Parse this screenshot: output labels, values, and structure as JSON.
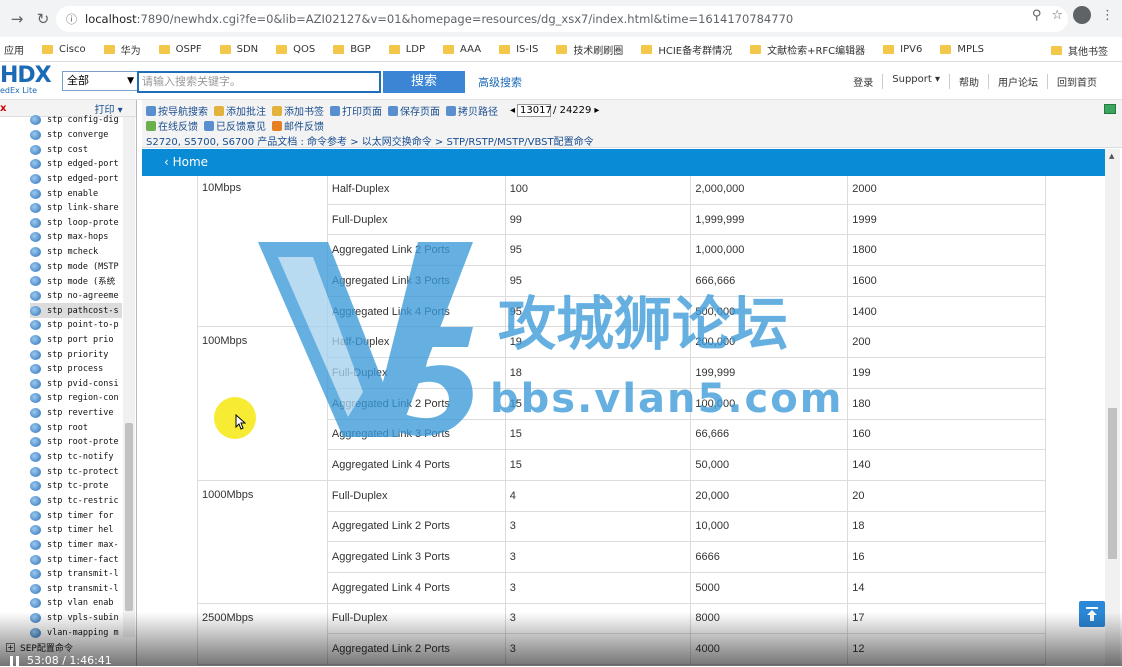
{
  "browser": {
    "url_host": "localhost",
    "url_rest": ":7890/newhdx.cgi?fe=0&lib=AZI02127&v=01&homepage=resources/dg_xsx7/index.html&time=1614170784770",
    "bookmarks": [
      "应用",
      "Cisco",
      "华为",
      "OSPF",
      "SDN",
      "QOS",
      "BGP",
      "LDP",
      "AAA",
      "IS-IS",
      "技术刷刷圈",
      "HCIE备考群情况",
      "文献检索+RFC编辑器",
      "IPV6",
      "MPLS"
    ],
    "other_bookmarks": "其他书签"
  },
  "header": {
    "logo_big": "HDX",
    "logo_small": "edEx Lite",
    "scope": "全部",
    "search_placeholder": "请输入搜索关键字。",
    "search_button": "搜索",
    "advanced_search": "高级搜索",
    "links": [
      "登录",
      "Support ▾",
      "帮助",
      "用户论坛",
      "回到首页"
    ]
  },
  "left_panel": {
    "close": "x",
    "print": "打印 ▾",
    "tree_items": [
      "stp config-dig",
      "stp converge",
      "stp cost",
      "stp edged-port",
      "stp edged-port",
      "stp enable",
      "stp link-share",
      "stp loop-prote",
      "stp max-hops",
      "stp mcheck",
      "stp mode (MSTP",
      "stp mode (系统",
      "stp no-agreeme",
      "stp pathcost-s",
      "stp point-to-p",
      "stp port prio",
      "stp priority",
      "stp process",
      "stp pvid-consi",
      "stp region-con",
      "stp revertive",
      "stp root",
      "stp root-prote",
      "stp tc-notify",
      "stp tc-protect",
      "stp tc-prote",
      "stp tc-restric",
      "stp timer for",
      "stp timer hel",
      "stp timer max-",
      "stp timer-fact",
      "stp transmit-l",
      "stp transmit-l",
      "stp vlan enab",
      "stp vpls-subin",
      "vlan-mapping m"
    ],
    "selected_index": 13,
    "bottom_item": "SEP配置命令"
  },
  "toolbar": {
    "items_row1": [
      "按导航搜索",
      "添加批注",
      "添加书签",
      "打印页面",
      "保存页面",
      "拷贝路径"
    ],
    "page_current": "13017",
    "page_total": "/ 24229",
    "items_row2": [
      "在线反馈",
      "已反馈意见",
      "邮件反馈"
    ],
    "breadcrumb": "S2720, S5700, S6700 产品文档 : 命令参考 > 以太网交换命令 > STP/RSTP/MSTP/VBST配置命令"
  },
  "home": {
    "label": "Home"
  },
  "table": {
    "groups": [
      {
        "rate": "10Mbps",
        "rows": [
          [
            "Half-Duplex",
            "100",
            "2,000,000",
            "2000"
          ],
          [
            "Full-Duplex",
            "99",
            "1,999,999",
            "1999"
          ],
          [
            "Aggregated Link 2 Ports",
            "95",
            "1,000,000",
            "1800"
          ],
          [
            "Aggregated Link 3 Ports",
            "95",
            "666,666",
            "1600"
          ],
          [
            "Aggregated Link 4 Ports",
            "95",
            "500,000",
            "1400"
          ]
        ]
      },
      {
        "rate": "100Mbps",
        "rows": [
          [
            "Half-Duplex",
            "19",
            "200,000",
            "200"
          ],
          [
            "Full-Duplex",
            "18",
            "199,999",
            "199"
          ],
          [
            "Aggregated Link 2 Ports",
            "15",
            "100,000",
            "180"
          ],
          [
            "Aggregated Link 3 Ports",
            "15",
            "66,666",
            "160"
          ],
          [
            "Aggregated Link 4 Ports",
            "15",
            "50,000",
            "140"
          ]
        ]
      },
      {
        "rate": "1000Mbps",
        "rows": [
          [
            "Full-Duplex",
            "4",
            "20,000",
            "20"
          ],
          [
            "Aggregated Link 2 Ports",
            "3",
            "10,000",
            "18"
          ],
          [
            "Aggregated Link 3 Ports",
            "3",
            "6666",
            "16"
          ],
          [
            "Aggregated Link 4 Ports",
            "3",
            "5000",
            "14"
          ]
        ]
      },
      {
        "rate": "2500Mbps",
        "rows": [
          [
            "Full-Duplex",
            "3",
            "8000",
            "17"
          ],
          [
            "Aggregated Link 2 Ports",
            "3",
            "4000",
            "12"
          ]
        ]
      }
    ]
  },
  "watermark": {
    "title": "攻城狮论坛",
    "url": "bbs.vlan5.com"
  },
  "video": {
    "time": "53:08 / 1:46:41"
  },
  "colors": {
    "accent": "#0a8bd6",
    "link": "#1a4d8f",
    "watermark": "#3a9ad9"
  }
}
